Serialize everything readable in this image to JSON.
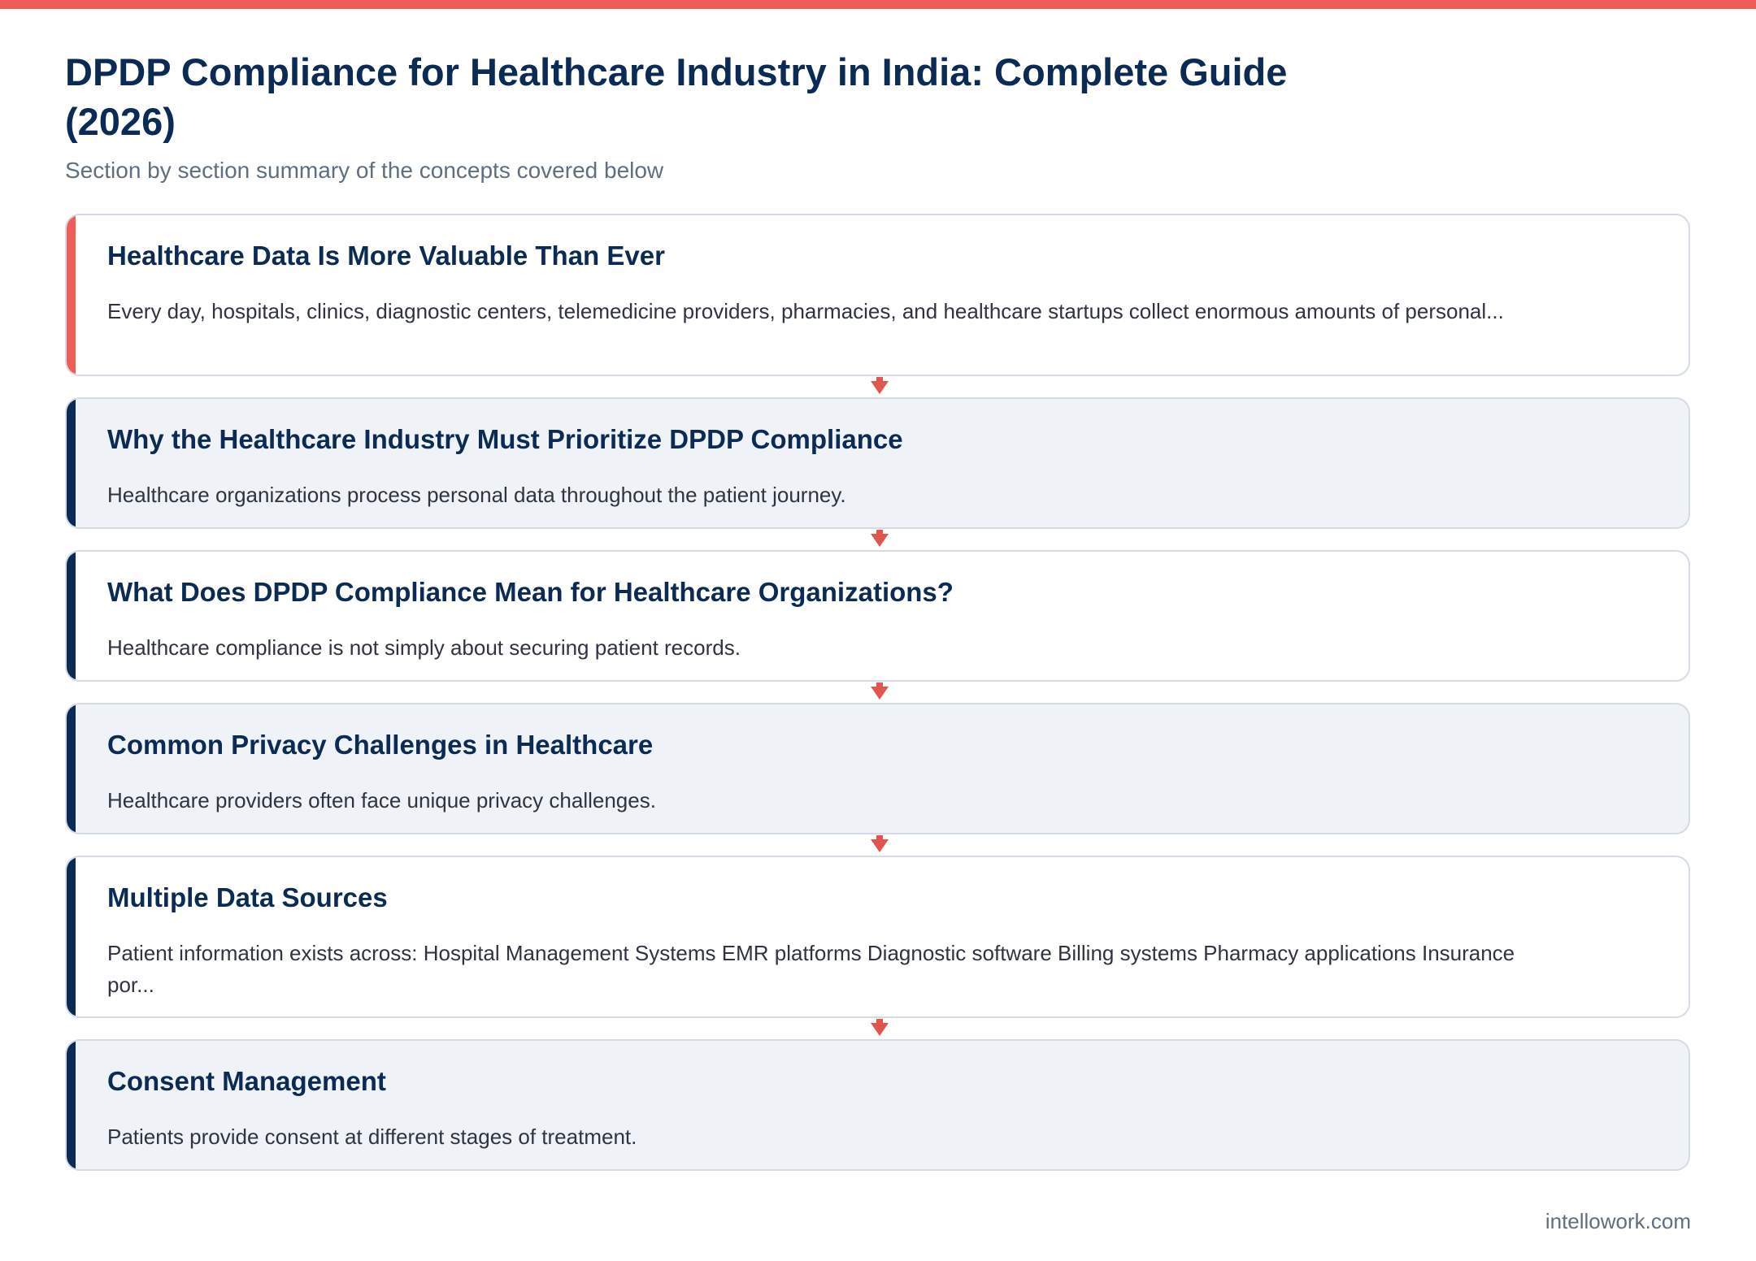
{
  "title": "DPDP Compliance for Healthcare Industry in India: Complete Guide (2026)",
  "subtitle": "Section by section summary of the concepts covered below",
  "sections": [
    {
      "title": "Healthcare Data Is More Valuable Than Ever",
      "summary": "Every day, hospitals, clinics, diagnostic centers, telemedicine providers, pharmacies, and healthcare startups collect enormous amounts of personal..."
    },
    {
      "title": "Why the Healthcare Industry Must Prioritize DPDP Compliance",
      "summary": "Healthcare organizations process personal data throughout the patient journey."
    },
    {
      "title": "What Does DPDP Compliance Mean for Healthcare Organizations?",
      "summary": "Healthcare compliance is not simply about securing patient records."
    },
    {
      "title": "Common Privacy Challenges in Healthcare",
      "summary": "Healthcare providers often face unique privacy challenges."
    },
    {
      "title": "Multiple Data Sources",
      "summary": "Patient information exists across: Hospital Management Systems EMR platforms Diagnostic software Billing systems Pharmacy applications Insurance por..."
    },
    {
      "title": "Consent Management",
      "summary": "Patients provide consent at different stages of treatment."
    }
  ],
  "footer": {
    "site": "intellowork.com"
  },
  "colors": {
    "accent": "#f05c58",
    "navy": "#0b2b55",
    "card_alt_bg": "#eff3f7",
    "border": "#d3dce6"
  }
}
